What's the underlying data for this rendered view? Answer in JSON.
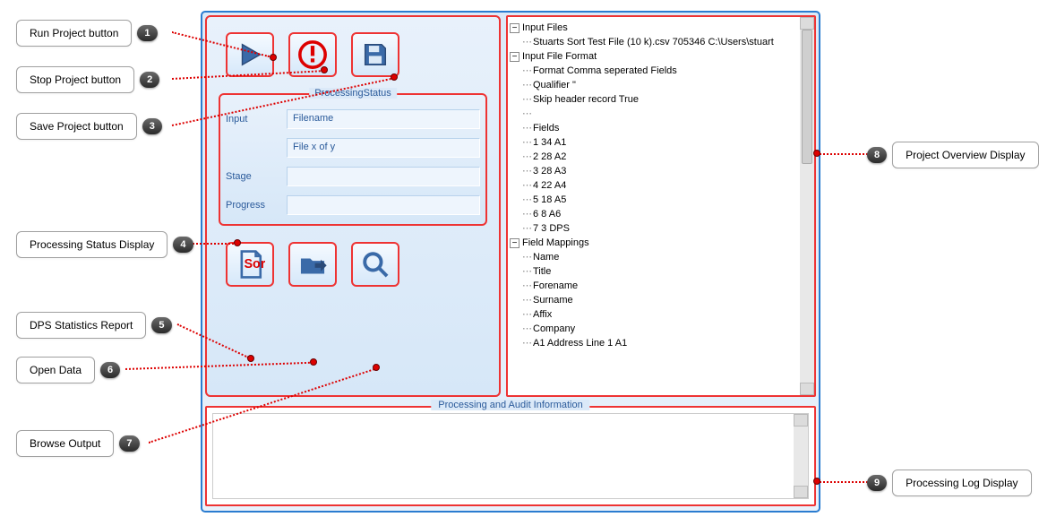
{
  "callouts": {
    "c1": "Run Project button",
    "c2": "Stop Project button",
    "c3": "Save Project button",
    "c4": "Processing Status Display",
    "c5": "DPS Statistics Report",
    "c6": "Open Data",
    "c7": "Browse Output",
    "c8": "Project Overview Display",
    "c9": "Processing Log Display"
  },
  "statusbox": {
    "title": "ProcessingStatus",
    "labels": {
      "input": "Input",
      "stage": "Stage",
      "progress": "Progress"
    },
    "fields": {
      "filename": "Filename",
      "filexofy": "File x of y"
    }
  },
  "tree": {
    "n_inputfiles": "Input Files",
    "n_file": "Stuarts Sort Test File  (10 k).csv  705346  C:\\Users\\stuart",
    "n_inputfileformat": "Input File Format",
    "n_format": "Format  Comma seperated Fields",
    "n_qualifier": "Qualifier  \"",
    "n_skipheader": "Skip header record  True",
    "n_fields": "Fields",
    "f1": "1  34    A1",
    "f2": "2  28    A2",
    "f3": "3  28    A3",
    "f4": "4  22    A4",
    "f5": "5  18    A5",
    "f6": "6  8     A6",
    "f7": "7  3     DPS",
    "n_fieldmappings": "Field Mappings",
    "m1": "Name",
    "m2": "Title",
    "m3": "Forename",
    "m4": "Surname",
    "m5": "Affix",
    "m6": "Company",
    "m7": "A1  Address Line 1  A1"
  },
  "bottom": {
    "title": "Processing and Audit Information"
  },
  "splitter": "· · · · · · · · ·",
  "icons": {
    "sort_label": "Sort"
  }
}
